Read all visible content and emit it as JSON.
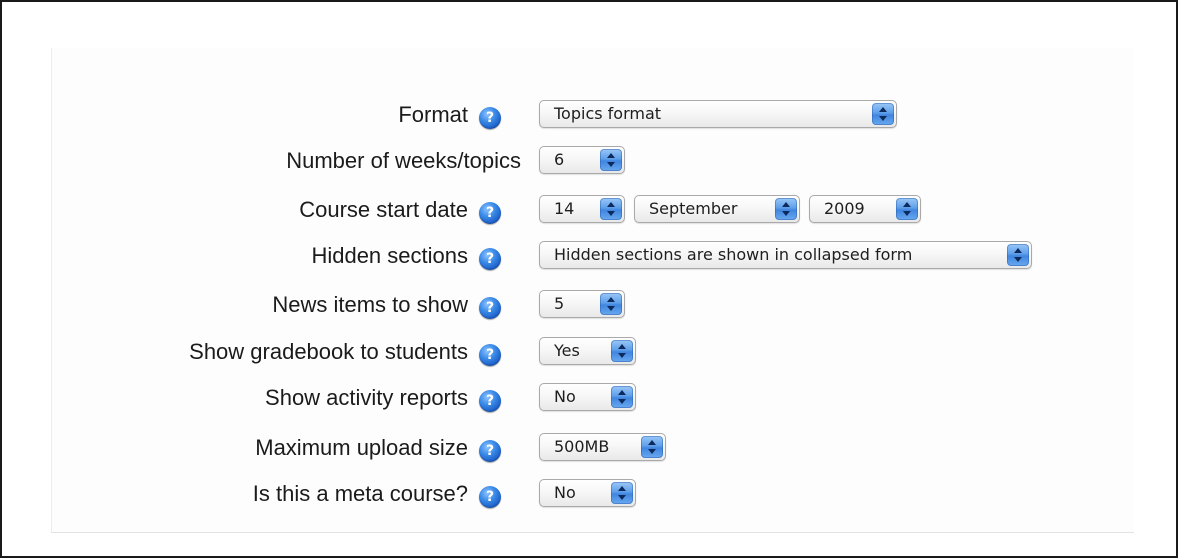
{
  "icons": {
    "help": "help-question-icon",
    "help_glyph": "?",
    "select_arrows": "up-down-arrows-icon"
  },
  "colors": {
    "help_icon": "#2f7be0",
    "select_arrow_bg": "#5e9fea",
    "frame_border": "#1a1a1a"
  },
  "form": {
    "fields": [
      {
        "label": "Format",
        "help": true,
        "selects": [
          {
            "value": "Topics format"
          }
        ]
      },
      {
        "label": "Number of weeks/topics",
        "help": false,
        "selects": [
          {
            "value": "6"
          }
        ]
      },
      {
        "label": "Course start date",
        "help": true,
        "selects": [
          {
            "value": "14"
          },
          {
            "value": "September"
          },
          {
            "value": "2009"
          }
        ]
      },
      {
        "label": "Hidden sections",
        "help": true,
        "selects": [
          {
            "value": "Hidden sections are shown in collapsed form"
          }
        ]
      },
      {
        "label": "News items to show",
        "help": true,
        "selects": [
          {
            "value": "5"
          }
        ]
      },
      {
        "label": "Show gradebook to students",
        "help": true,
        "selects": [
          {
            "value": "Yes"
          }
        ]
      },
      {
        "label": "Show activity reports",
        "help": true,
        "selects": [
          {
            "value": "No"
          }
        ]
      },
      {
        "label": "Maximum upload size",
        "help": true,
        "selects": [
          {
            "value": "500MB"
          }
        ]
      },
      {
        "label": "Is this a meta course?",
        "help": true,
        "selects": [
          {
            "value": "No"
          }
        ]
      }
    ]
  }
}
